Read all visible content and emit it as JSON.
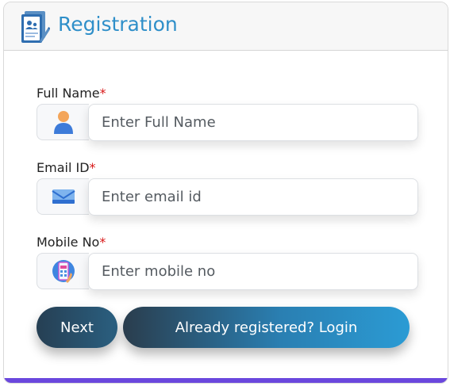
{
  "header": {
    "title": "Registration",
    "icon": "registration-form-icon"
  },
  "fields": [
    {
      "label": "Full Name",
      "required_mark": "*",
      "placeholder": "Enter Full Name",
      "value": "",
      "icon": "person-icon"
    },
    {
      "label": "Email ID",
      "required_mark": "*",
      "placeholder": "Enter email id",
      "value": "",
      "icon": "envelope-icon"
    },
    {
      "label": "Mobile No",
      "required_mark": "*",
      "placeholder": "Enter mobile no",
      "value": "",
      "icon": "mobile-phone-icon"
    }
  ],
  "buttons": {
    "next_label": "Next",
    "login_label": "Already registered? Login"
  },
  "colors": {
    "title": "#2f8fc9",
    "required": "#d81818",
    "bottom_bar": "#6a47dd",
    "button_dark": "#263f53",
    "button_light": "#2b9bd4"
  }
}
